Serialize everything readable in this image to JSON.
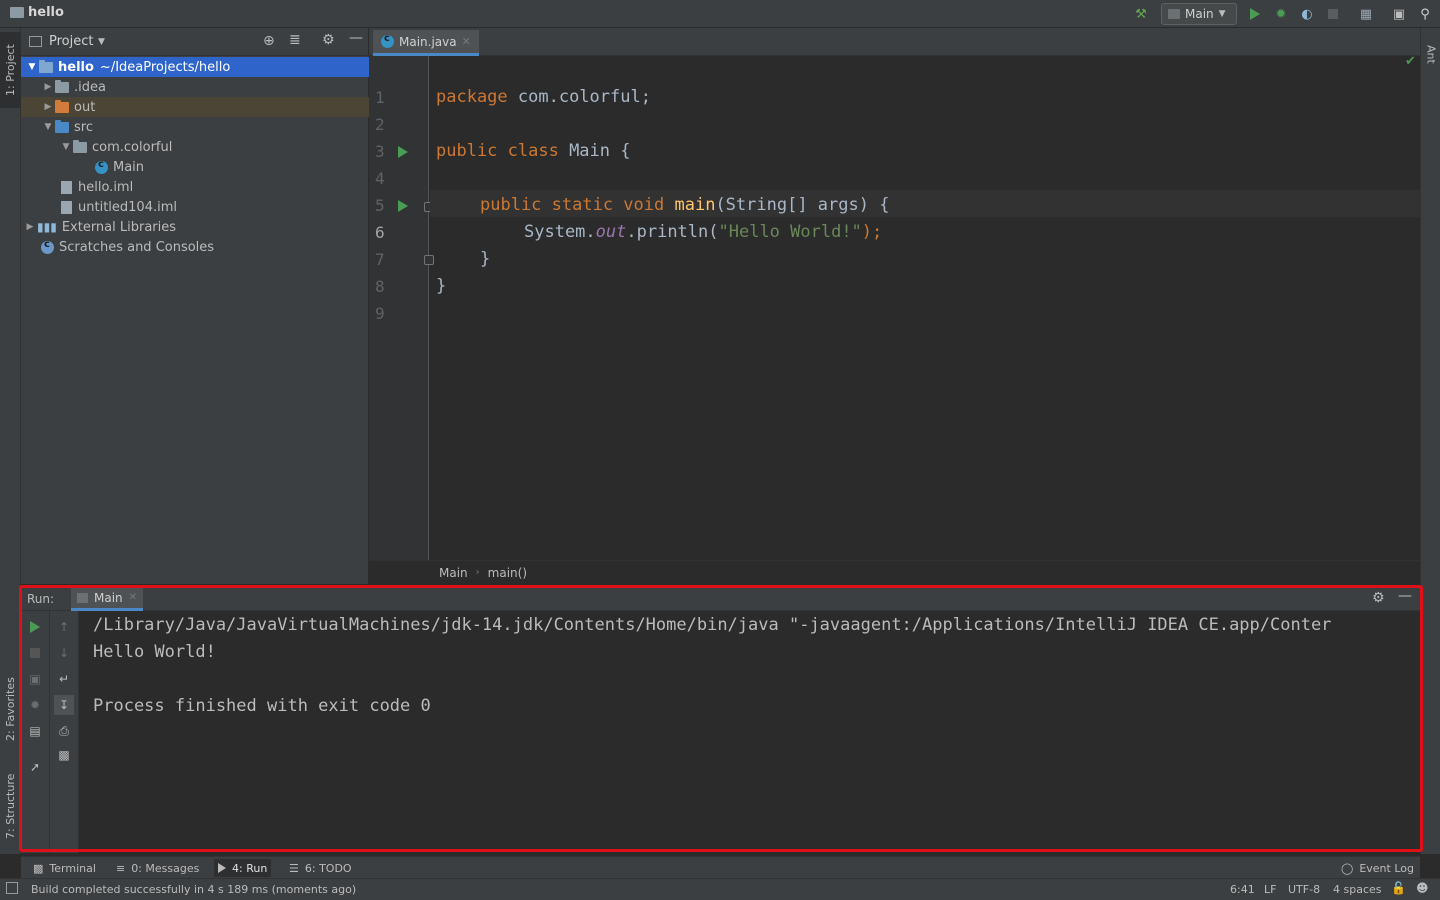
{
  "window": {
    "project_name": "hello"
  },
  "toolbar": {
    "run_config": "Main"
  },
  "left_strip": {
    "project_tab": "1: Project",
    "favorites_tab": "2: Favorites",
    "structure_tab": "7: Structure"
  },
  "right_strip": {
    "ant_tab": "Ant"
  },
  "project_panel": {
    "title": "Project",
    "tree": [
      {
        "label": "hello",
        "suffix": "~/IdeaProjects/hello"
      },
      {
        "label": ".idea"
      },
      {
        "label": "out"
      },
      {
        "label": "src"
      },
      {
        "label": "com.colorful"
      },
      {
        "label": "Main"
      },
      {
        "label": "hello.iml"
      },
      {
        "label": "untitled104.iml"
      },
      {
        "label": "External Libraries"
      },
      {
        "label": "Scratches and Consoles"
      }
    ]
  },
  "editor": {
    "tab": "Main.java",
    "line_numbers": [
      "1",
      "2",
      "3",
      "4",
      "5",
      "6",
      "7",
      "8",
      "9"
    ],
    "code": {
      "l1_kw": "package",
      "l1_rest": " com.colorful;",
      "l3_kw": "public class",
      "l3_rest": " Main {",
      "l5_kw": "public static void",
      "l5_fn": "main",
      "l5_rest": "(String[] args) {",
      "l6_a": "System.",
      "l6_out": "out",
      "l6_b": ".println(",
      "l6_str": "\"Hello World!\"",
      "l6_c": ");",
      "l7": "}",
      "l8": "}"
    },
    "breadcrumb": [
      "Main",
      "main()"
    ]
  },
  "run_panel": {
    "label": "Run:",
    "tab": "Main",
    "console": [
      "/Library/Java/JavaVirtualMachines/jdk-14.jdk/Contents/Home/bin/java \"-javaagent:/Applications/IntelliJ IDEA CE.app/Conter",
      "Hello World!",
      "",
      "Process finished with exit code 0"
    ]
  },
  "bottom_tabs": {
    "terminal": "Terminal",
    "messages": "0: Messages",
    "run": "4: Run",
    "todo": "6: TODO",
    "event_log": "Event Log"
  },
  "status_bar": {
    "message": "Build completed successfully in 4 s 189 ms (moments ago)",
    "position": "6:41",
    "line_sep": "LF",
    "encoding": "UTF-8",
    "indent": "4 spaces"
  },
  "colors": {
    "selection": "#2f65ca",
    "accent_red": "#e01018",
    "run_green": "#499c54"
  }
}
